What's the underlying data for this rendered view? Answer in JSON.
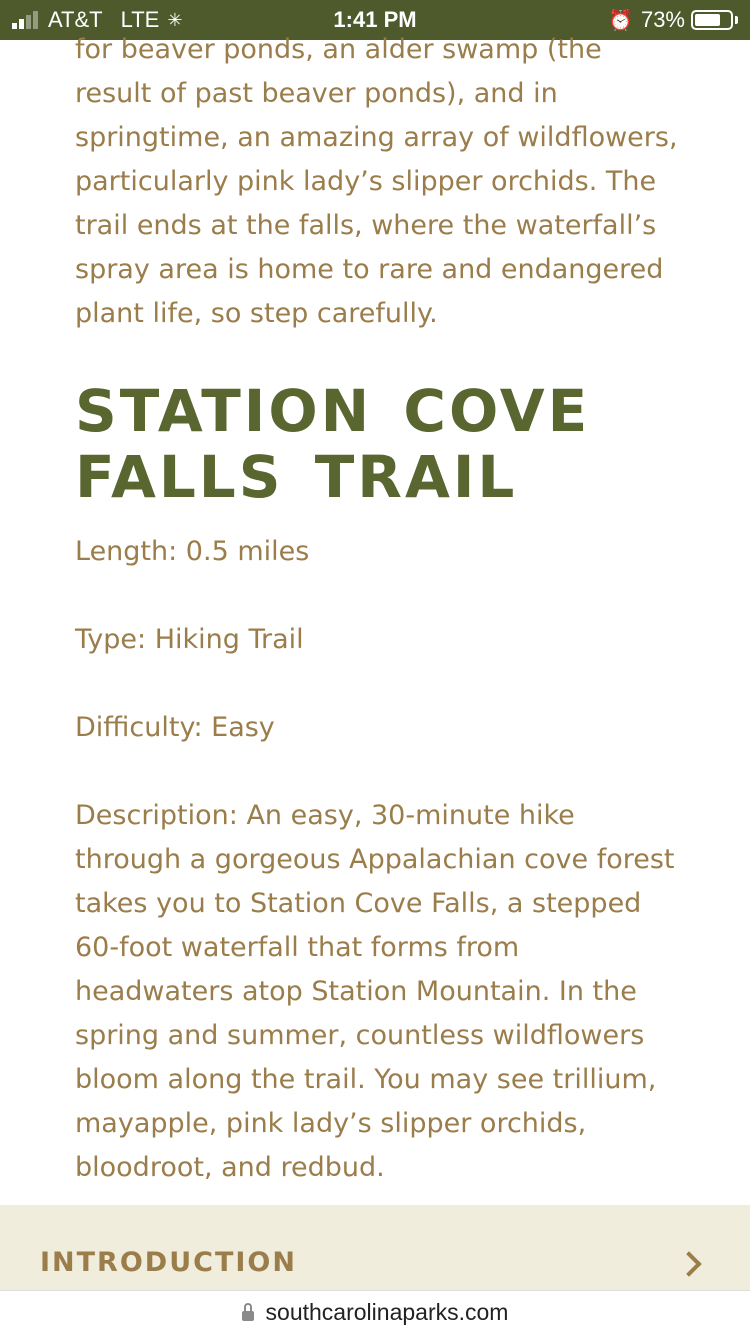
{
  "status_bar": {
    "carrier": "AT&T",
    "network": "LTE",
    "time": "1:41 PM",
    "battery_percent": "73%",
    "battery_level": 0.73
  },
  "article": {
    "intro_paragraph": "for beaver ponds, an alder swamp (the result of past beaver ponds), and in springtime, an amazing array of wildflowers, particularly pink lady’s slipper orchids. The trail ends at the falls, where the waterfall’s spray area is home to rare and endangered plant life, so step carefully.",
    "section_title": "STATION COVE FALLS TRAIL",
    "length": "Length: 0.5 miles",
    "type": "Type: Hiking Trail",
    "difficulty": "Difficulty: Easy",
    "description": "Description: An easy, 30-minute hike through a gorgeous Appalachian cove forest takes you to Station Cove Falls, a stepped 60-foot waterfall that forms from headwaters atop Station Mountain. In the spring and summer, countless wildflowers bloom along the trail. You may see trillium, mayapple, pink lady’s slipper orchids, bloodroot, and redbud."
  },
  "accordion": {
    "label": "INTRODUCTION"
  },
  "url_bar": {
    "domain": "southcarolinaparks.com"
  },
  "colors": {
    "status_bar_bg": "#4e5a2c",
    "body_text": "#9a7d4a",
    "heading": "#5a6630",
    "accordion_bg": "#f0eddc"
  }
}
